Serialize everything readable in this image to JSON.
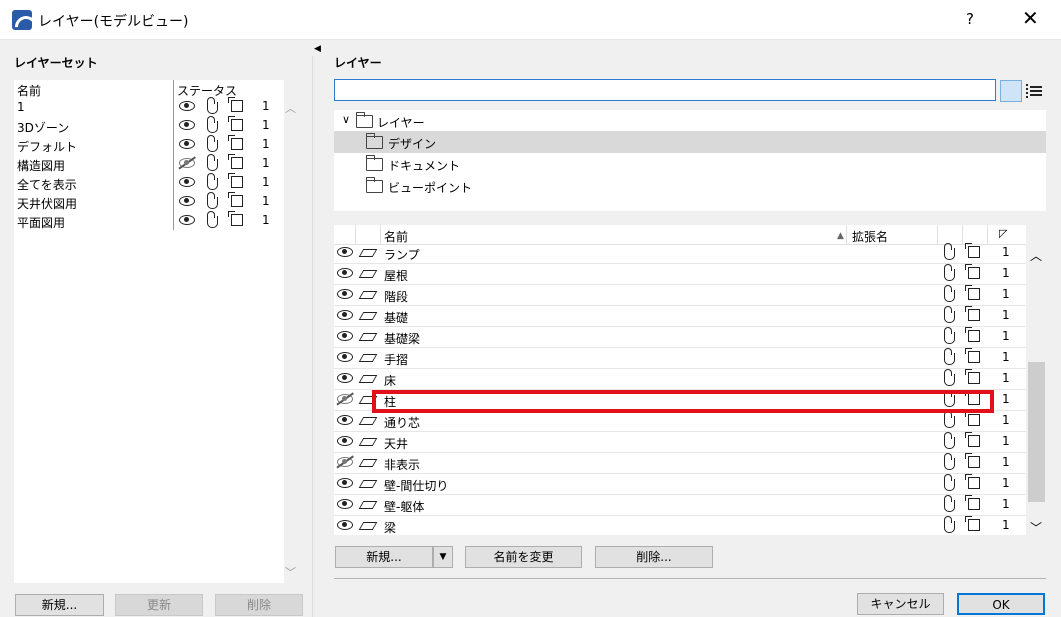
{
  "window": {
    "title": "レイヤー(モデルビュー)",
    "help": "?",
    "close": "✕"
  },
  "left": {
    "section_title": "レイヤーセット",
    "col_name": "名前",
    "col_status": "ステータス",
    "rows": [
      {
        "name": "1",
        "visible": true,
        "count": "1"
      },
      {
        "name": "3Dゾーン",
        "visible": true,
        "count": "1"
      },
      {
        "name": "デフォルト",
        "visible": true,
        "count": "1"
      },
      {
        "name": "構造図用",
        "visible": false,
        "count": "1"
      },
      {
        "name": "全てを表示",
        "visible": true,
        "count": "1"
      },
      {
        "name": "天井伏図用",
        "visible": true,
        "count": "1"
      },
      {
        "name": "平面図用",
        "visible": true,
        "count": "1"
      }
    ],
    "buttons": {
      "new": "新規...",
      "update": "更新",
      "delete": "削除"
    }
  },
  "right": {
    "section_title": "レイヤー",
    "search": {
      "value": "",
      "placeholder": ""
    },
    "tree": {
      "root": "レイヤー",
      "folders": [
        "デザイン",
        "ドキュメント",
        "ビューポイント"
      ],
      "selected": "デザイン"
    },
    "table": {
      "col_name": "名前",
      "col_ext": "拡張名",
      "rows": [
        {
          "name": "ランプ",
          "visible": true,
          "count": "1"
        },
        {
          "name": "屋根",
          "visible": true,
          "count": "1"
        },
        {
          "name": "階段",
          "visible": true,
          "count": "1"
        },
        {
          "name": "基礎",
          "visible": true,
          "count": "1"
        },
        {
          "name": "基礎梁",
          "visible": true,
          "count": "1"
        },
        {
          "name": "手摺",
          "visible": true,
          "count": "1"
        },
        {
          "name": "床",
          "visible": true,
          "count": "1"
        },
        {
          "name": "柱",
          "visible": false,
          "count": "1"
        },
        {
          "name": "通り芯",
          "visible": true,
          "count": "1"
        },
        {
          "name": "天井",
          "visible": true,
          "count": "1"
        },
        {
          "name": "非表示",
          "visible": false,
          "count": "1"
        },
        {
          "name": "壁-間仕切り",
          "visible": true,
          "count": "1"
        },
        {
          "name": "壁-躯体",
          "visible": true,
          "count": "1"
        },
        {
          "name": "梁",
          "visible": true,
          "count": "1"
        }
      ]
    },
    "buttons": {
      "new": "新規...",
      "rename": "名前を変更",
      "delete": "削除..."
    }
  },
  "footer": {
    "cancel": "キャンセル",
    "ok": "OK"
  },
  "colors": {
    "highlight": "#e3101a",
    "accent": "#0078d7"
  }
}
